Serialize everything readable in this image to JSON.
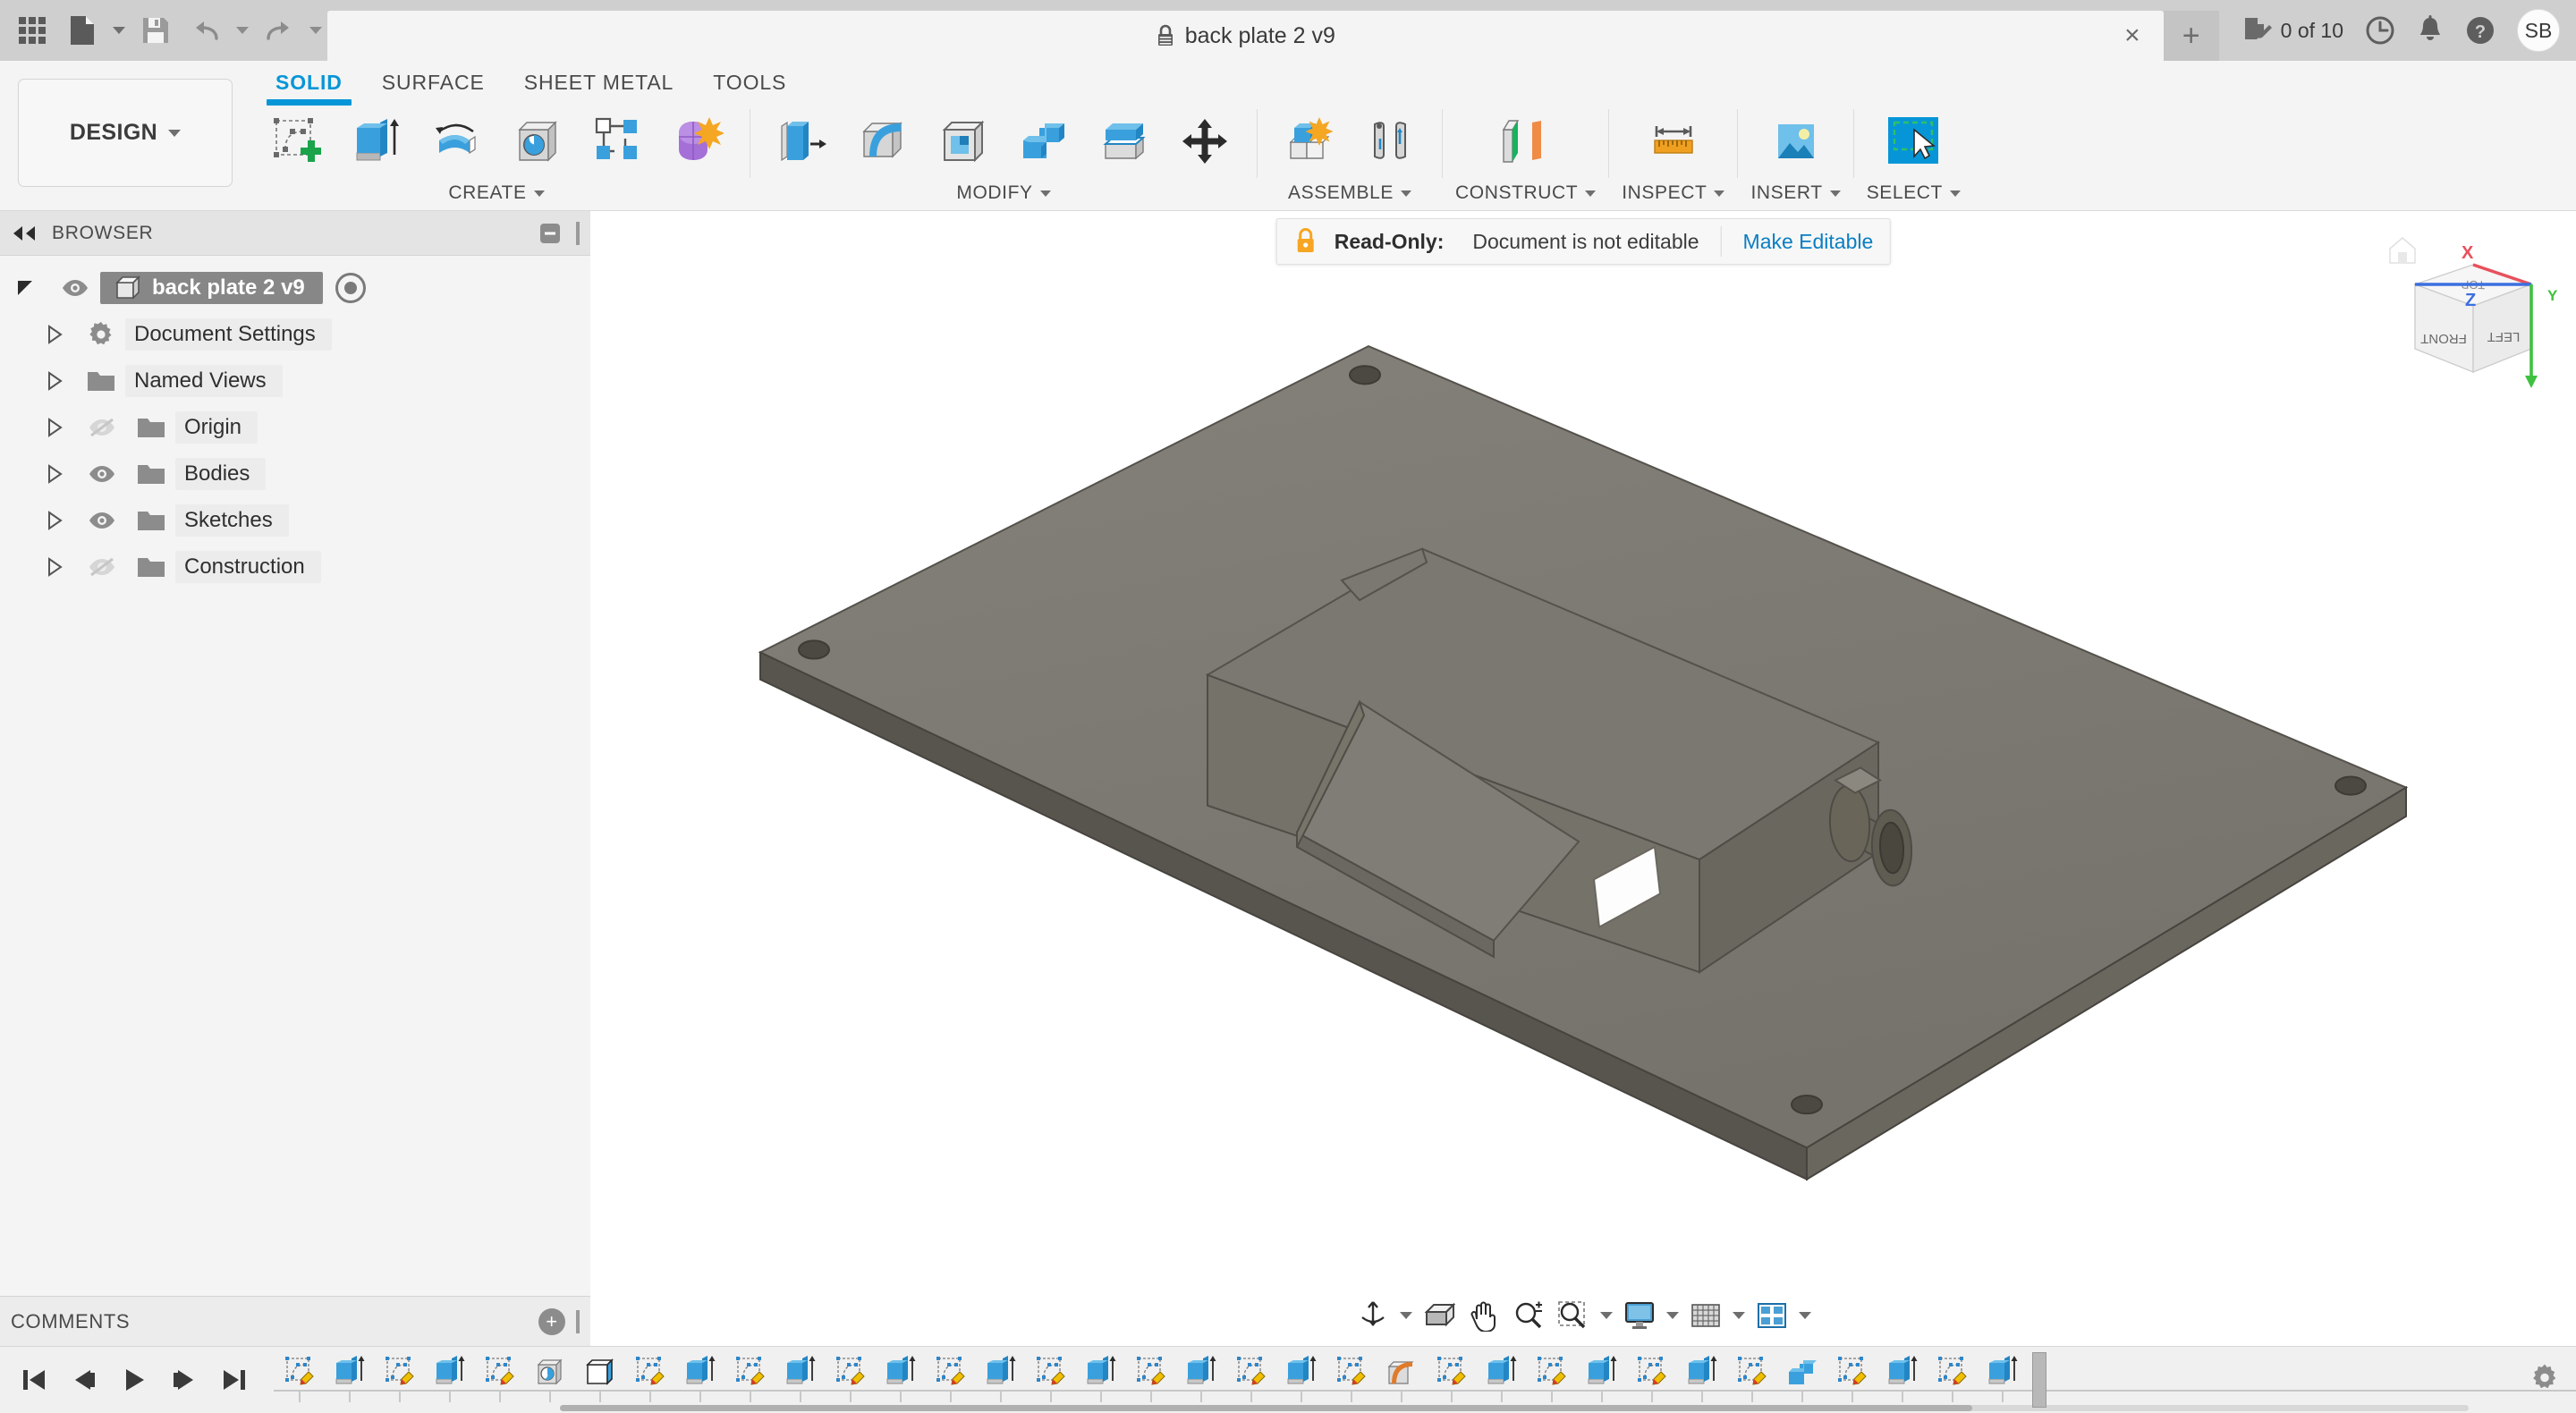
{
  "app": {
    "name": "Fusion 360",
    "accent": "#0696d7",
    "bg": "#f4f4f4"
  },
  "titlebar": {
    "quick_access": [
      {
        "name": "app-grid",
        "label": "Show Data Panel"
      },
      {
        "name": "file",
        "label": "File"
      },
      {
        "name": "save",
        "label": "Save"
      },
      {
        "name": "undo",
        "label": "Undo"
      },
      {
        "name": "redo",
        "label": "Redo"
      }
    ],
    "tab": {
      "title": "back plate 2 v9",
      "locked": true,
      "close_label": "×"
    },
    "new_tab_label": "+",
    "edit_count": "0 of 10",
    "avatar_initials": "SB",
    "right_icons": [
      {
        "name": "job-status-icon",
        "label": "Job Status"
      },
      {
        "name": "history-clock-icon",
        "label": "Recent"
      },
      {
        "name": "notifications-bell-icon",
        "label": "Notifications"
      },
      {
        "name": "help-icon",
        "label": "Help"
      }
    ]
  },
  "ribbon": {
    "workspace": "DESIGN",
    "tabs": [
      {
        "label": "SOLID",
        "active": true
      },
      {
        "label": "SURFACE",
        "active": false
      },
      {
        "label": "SHEET METAL",
        "active": false
      },
      {
        "label": "TOOLS",
        "active": false
      }
    ],
    "groups": [
      {
        "label": "CREATE",
        "dropdown": true,
        "tools": [
          {
            "name": "create-sketch-icon",
            "label": "Create Sketch"
          },
          {
            "name": "extrude-icon",
            "label": "Extrude"
          },
          {
            "name": "revolve-icon",
            "label": "Revolve"
          },
          {
            "name": "hole-icon",
            "label": "Hole"
          },
          {
            "name": "rectangular-pattern-icon",
            "label": "Rectangular Pattern"
          },
          {
            "name": "form-icon",
            "label": "Create Form"
          }
        ]
      },
      {
        "label": "MODIFY",
        "dropdown": true,
        "tools": [
          {
            "name": "press-pull-icon",
            "label": "Press Pull"
          },
          {
            "name": "fillet-icon",
            "label": "Fillet"
          },
          {
            "name": "shell-icon",
            "label": "Shell"
          },
          {
            "name": "combine-icon",
            "label": "Combine"
          },
          {
            "name": "offset-face-icon",
            "label": "Offset Face"
          },
          {
            "name": "move-copy-icon",
            "label": "Move/Copy"
          }
        ]
      },
      {
        "label": "ASSEMBLE",
        "dropdown": true,
        "tools": [
          {
            "name": "new-component-icon",
            "label": "New Component"
          },
          {
            "name": "joint-icon",
            "label": "Joint"
          }
        ]
      },
      {
        "label": "CONSTRUCT",
        "dropdown": true,
        "tools": [
          {
            "name": "offset-plane-icon",
            "label": "Offset Plane"
          }
        ]
      },
      {
        "label": "INSPECT",
        "dropdown": true,
        "tools": [
          {
            "name": "measure-icon",
            "label": "Measure"
          }
        ]
      },
      {
        "label": "INSERT",
        "dropdown": true,
        "tools": [
          {
            "name": "insert-image-icon",
            "label": "Canvas"
          }
        ]
      },
      {
        "label": "SELECT",
        "dropdown": true,
        "tools": [
          {
            "name": "select-cursor-icon",
            "label": "Select",
            "active": true
          }
        ]
      }
    ]
  },
  "browser": {
    "header": "BROWSER",
    "tree": [
      {
        "label": "back plate 2 v9",
        "icon": "component-icon",
        "eye": "visible",
        "root": true,
        "depth": 0
      },
      {
        "label": "Document Settings",
        "icon": "gear-icon",
        "eye": "none",
        "depth": 1
      },
      {
        "label": "Named Views",
        "icon": "folder-icon",
        "eye": "none",
        "depth": 1
      },
      {
        "label": "Origin",
        "icon": "folder-icon",
        "eye": "hidden",
        "depth": 1
      },
      {
        "label": "Bodies",
        "icon": "folder-icon",
        "eye": "visible",
        "depth": 1
      },
      {
        "label": "Sketches",
        "icon": "folder-icon",
        "eye": "visible",
        "depth": 1
      },
      {
        "label": "Construction",
        "icon": "folder-icon",
        "eye": "hidden",
        "depth": 1
      }
    ],
    "comments_label": "COMMENTS"
  },
  "canvas": {
    "read_only_banner": {
      "lock_color": "#f6a623",
      "strong": "Read-Only:",
      "text": "Document is not editable",
      "link": "Make Editable"
    },
    "viewcube": {
      "faces": {
        "front": "FRONT",
        "left": "LEFT",
        "top": "TOP"
      },
      "axes": [
        {
          "label": "X",
          "color": "#e8505b"
        },
        {
          "label": "Y",
          "color": "#3ec13e"
        },
        {
          "label": "Z",
          "color": "#3b6fe0"
        }
      ]
    },
    "model": {
      "description": "Isometric grey back plate with raised enclosure block and circular port",
      "body_color": "#7d7a71",
      "top_face_color": "#86837a",
      "side_face_color": "#6e6b63"
    },
    "navbar": [
      {
        "name": "orbit-icon",
        "label": "Orbit",
        "dropdown": true
      },
      {
        "name": "look-at-icon",
        "label": "Look At",
        "dropdown": false
      },
      {
        "name": "pan-hand-icon",
        "label": "Pan",
        "dropdown": false
      },
      {
        "name": "zoom-icon",
        "label": "Zoom",
        "dropdown": false
      },
      {
        "name": "zoom-window-icon",
        "label": "Fit",
        "dropdown": true
      },
      {
        "name": "display-settings-icon",
        "label": "Display Settings",
        "dropdown": true
      },
      {
        "name": "grid-snaps-icon",
        "label": "Grid and Snaps",
        "dropdown": true
      },
      {
        "name": "viewports-icon",
        "label": "Viewports",
        "dropdown": true
      }
    ]
  },
  "timeline": {
    "playback": [
      {
        "name": "timeline-begin-icon",
        "label": "Go to beginning"
      },
      {
        "name": "timeline-step-back-icon",
        "label": "Step back"
      },
      {
        "name": "timeline-play-icon",
        "label": "Play"
      },
      {
        "name": "timeline-step-forward-icon",
        "label": "Step forward"
      },
      {
        "name": "timeline-end-icon",
        "label": "Go to end"
      }
    ],
    "features": [
      "sketch",
      "extrude",
      "sketch",
      "extrude",
      "sketch",
      "hole",
      "shell",
      "sketch",
      "extrude",
      "sketch",
      "extrude",
      "sketch",
      "extrude",
      "sketch",
      "extrude",
      "sketch",
      "extrude",
      "sketch",
      "extrude",
      "sketch",
      "extrude",
      "sketch",
      "fillet",
      "sketch",
      "extrude",
      "sketch",
      "extrude",
      "sketch",
      "extrude",
      "sketch",
      "combine",
      "sketch",
      "extrude",
      "sketch",
      "extrude"
    ],
    "settings_label": "Timeline Settings"
  }
}
